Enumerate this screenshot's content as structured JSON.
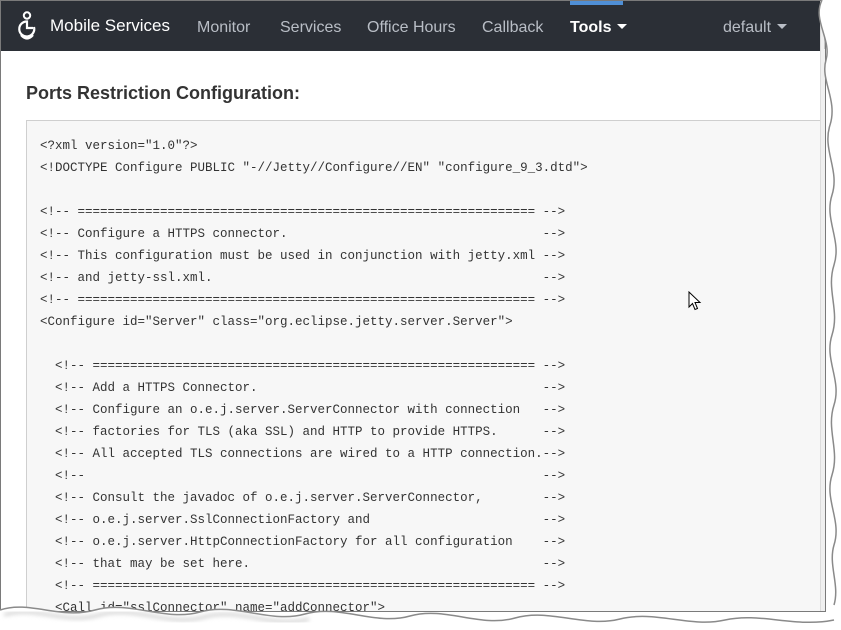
{
  "nav": {
    "brand": "Mobile Services",
    "items": [
      {
        "label": "Monitor"
      },
      {
        "label": "Services"
      },
      {
        "label": "Office Hours"
      },
      {
        "label": "Callback"
      },
      {
        "label": "Tools",
        "active": true
      }
    ],
    "account": "default"
  },
  "page": {
    "title": "Ports Restriction Configuration:",
    "code": "<?xml version=\"1.0\"?>\n<!DOCTYPE Configure PUBLIC \"-//Jetty//Configure//EN\" \"configure_9_3.dtd\">\n\n<!-- ============================================================= -->\n<!-- Configure a HTTPS connector.                                  -->\n<!-- This configuration must be used in conjunction with jetty.xml -->\n<!-- and jetty-ssl.xml.                                            -->\n<!-- ============================================================= -->\n<Configure id=\"Server\" class=\"org.eclipse.jetty.server.Server\">\n\n  <!-- =========================================================== -->\n  <!-- Add a HTTPS Connector.                                      -->\n  <!-- Configure an o.e.j.server.ServerConnector with connection   -->\n  <!-- factories for TLS (aka SSL) and HTTP to provide HTTPS.      -->\n  <!-- All accepted TLS connections are wired to a HTTP connection.-->\n  <!--                                                             -->\n  <!-- Consult the javadoc of o.e.j.server.ServerConnector,        -->\n  <!-- o.e.j.server.SslConnectionFactory and                       -->\n  <!-- o.e.j.server.HttpConnectionFactory for all configuration    -->\n  <!-- that may be set here.                                       -->\n  <!-- =========================================================== -->\n  <Call id=\"sslConnector\" name=\"addConnector\">"
  },
  "colors": {
    "nav_background": "#2b2f36",
    "nav_text": "#b9bec6",
    "active_indicator": "#4f8fd6",
    "code_background": "#f7f7f7"
  },
  "icons": {
    "logo": "genesys-g-icon",
    "dropdown": "caret-down-icon",
    "cursor": "mouse-pointer-icon"
  }
}
